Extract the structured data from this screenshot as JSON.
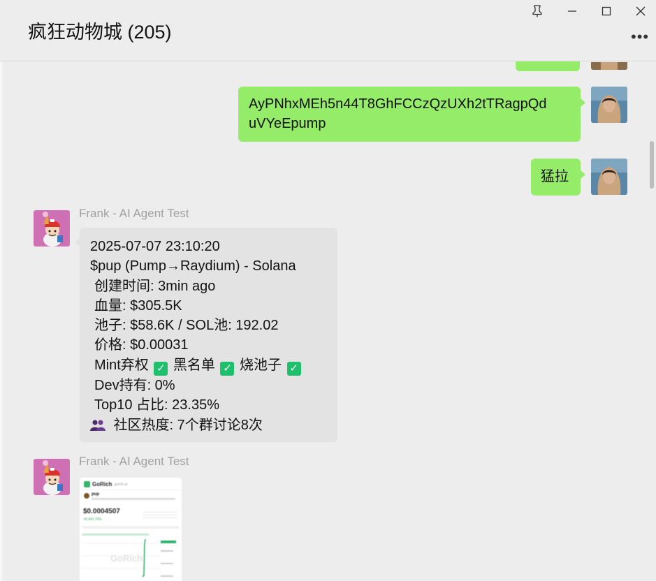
{
  "window": {
    "title": "疯狂动物城 (205)",
    "controls": [
      "pin-icon",
      "minimize-icon",
      "maximize-icon",
      "close-icon"
    ],
    "more_label": "•••"
  },
  "messages": {
    "sent_address": "AyPNhxMEh5n44T8GhFCCzQzUXh2tTRagpQduVYeEpump",
    "sent_address_line1": "AyPNhxMEh5n44T8GhFCCzQzUXh2tTRagpQd",
    "sent_address_line2": "uVYeEpump",
    "sent_short": "猛拉"
  },
  "incoming": {
    "sender_name": "Frank - AI Agent Test",
    "report": {
      "datetime": "2025-07-07 23:10:20",
      "token_line": "$pup (Pump→Raydium) - Solana",
      "created": "创建时间: 3min ago",
      "blood": "血量: $305.5K",
      "pool": "池子: $58.6K / SOL池: 192.02",
      "price": "价格: $0.00031",
      "mint_label": "Mint弃权",
      "blacklist_label": "黑名单",
      "burn_label": "烧池子",
      "dev": "Dev持有: 0%",
      "top10": "Top10 占比: 23.35%",
      "community": "社区热度: 7个群讨论8次"
    },
    "second_sender_name": "Frank - AI Agent Test",
    "image_card": {
      "brand": "GoRich",
      "domain": "gorich.ai",
      "token": "pup",
      "price": "$0.0004507",
      "change": "+8,443.76%",
      "watermark": "GoRich"
    }
  },
  "colors": {
    "sent_bubble": "#95ec69",
    "received_bubble": "#e3e3e3",
    "background": "#ededed",
    "check": "#1fbf6b"
  }
}
